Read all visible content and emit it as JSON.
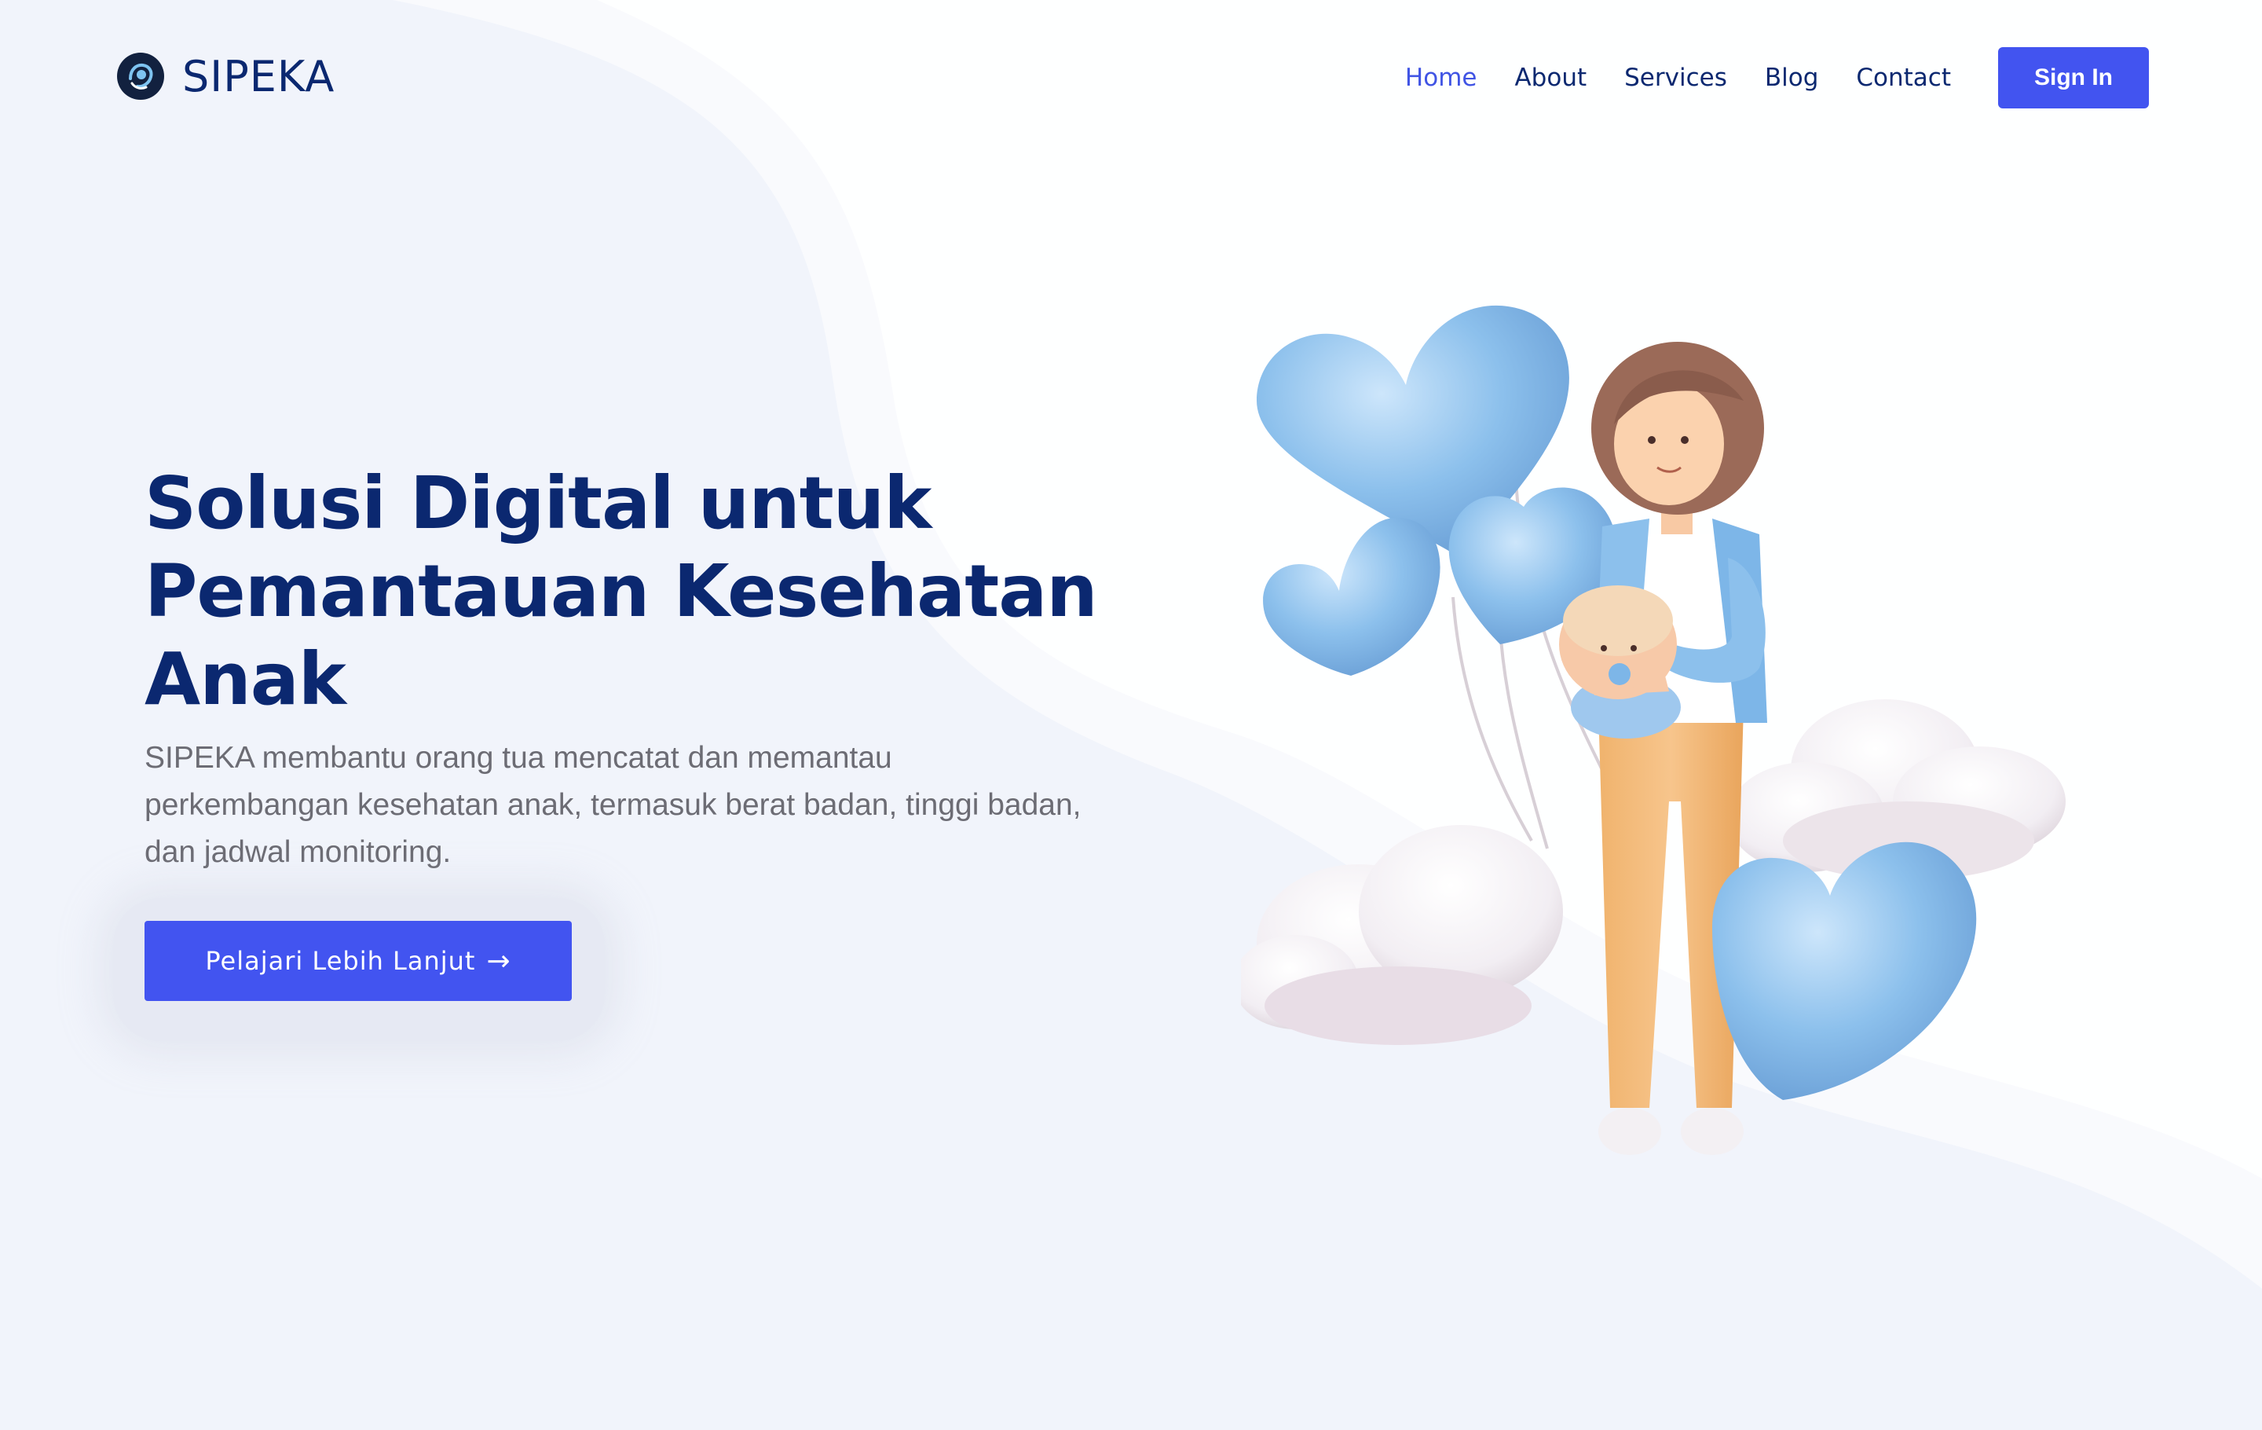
{
  "brand": {
    "name": "SIPEKA"
  },
  "nav": {
    "items": [
      {
        "label": "Home",
        "active": true
      },
      {
        "label": "About",
        "active": false
      },
      {
        "label": "Services",
        "active": false
      },
      {
        "label": "Blog",
        "active": false
      },
      {
        "label": "Contact",
        "active": false
      }
    ],
    "sign_in_label": "Sign In"
  },
  "hero": {
    "title_lines": [
      "Solusi Digital untuk",
      "Pemantauan Kesehatan",
      "Anak"
    ],
    "description_lines": [
      "SIPEKA membantu orang tua mencatat dan memantau",
      "perkembangan kesehatan anak, termasuk berat badan, tinggi badan,",
      "dan jadwal monitoring."
    ],
    "cta_label": "Pelajari Lebih Lanjut",
    "cta_icon": "arrow-right-icon"
  },
  "colors": {
    "primary": "#4254f0",
    "heading": "#0b2870",
    "nav_active": "#4054e4",
    "body_text": "#6c6c74",
    "background": "#f1f4fb"
  }
}
